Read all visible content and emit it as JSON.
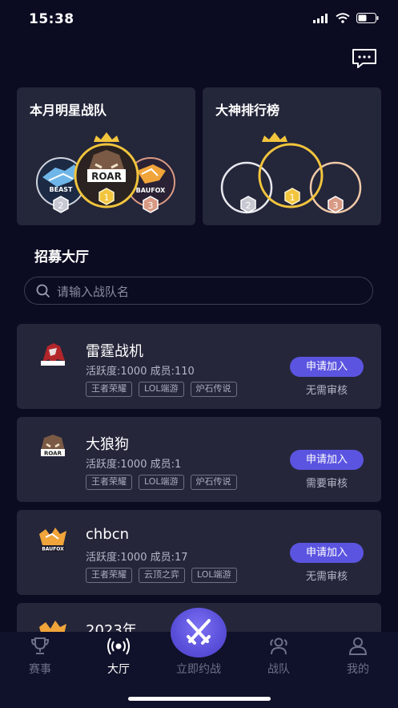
{
  "status_bar": {
    "time": "15:38"
  },
  "cards": {
    "star_team": {
      "title": "本月明星战队",
      "ranks": [
        "1",
        "2",
        "3"
      ],
      "logos": [
        "ROAR",
        "BEAST",
        "BAUFOX"
      ]
    },
    "leaderboard": {
      "title": "大神排行榜",
      "ranks": [
        "1",
        "2",
        "3"
      ]
    }
  },
  "hall": {
    "title": "招募大厅",
    "search_placeholder": "请输入战队名"
  },
  "teams": [
    {
      "name": "雷霆战机",
      "stats": "活跃度:1000 成员:110",
      "tags": [
        "王者荣耀",
        "LOL端游",
        "炉石传说"
      ],
      "join_label": "申请加入",
      "audit": "无需审核"
    },
    {
      "name": "大狼狗",
      "stats": "活跃度:1000 成员:1",
      "tags": [
        "王者荣耀",
        "LOL端游",
        "炉石传说"
      ],
      "join_label": "申请加入",
      "audit": "需要审核"
    },
    {
      "name": "chbcn",
      "stats": "活跃度:1000 成员:17",
      "tags": [
        "王者荣耀",
        "云顶之弈",
        "LOL端游"
      ],
      "join_label": "申请加入",
      "audit": "无需审核"
    },
    {
      "name": "2023年"
    }
  ],
  "tabs": [
    {
      "label": "赛事",
      "icon": "trophy-icon"
    },
    {
      "label": "大厅",
      "icon": "broadcast-icon"
    },
    {
      "label": "立即约战",
      "icon": "crossed-swords-icon"
    },
    {
      "label": "战队",
      "icon": "team-icon"
    },
    {
      "label": "我的",
      "icon": "user-icon"
    }
  ],
  "colors": {
    "accent": "#5b54e0",
    "gold": "#f2c53d",
    "silver": "#c6c8d2",
    "bronze": "#d89a84",
    "background": "#0b0b22",
    "card": "#25263a"
  }
}
